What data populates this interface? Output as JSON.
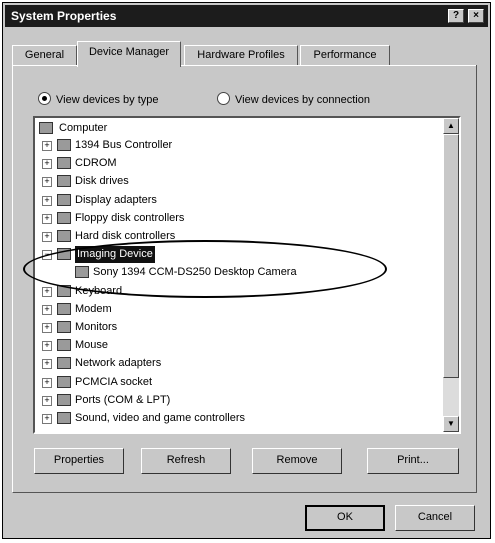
{
  "window": {
    "title": "System Properties",
    "help_btn": "?",
    "close_btn": "×"
  },
  "tabs": [
    {
      "label": "General"
    },
    {
      "label": "Device Manager"
    },
    {
      "label": "Hardware Profiles"
    },
    {
      "label": "Performance"
    }
  ],
  "radios": {
    "by_type": "View devices by type",
    "by_connection": "View devices by connection"
  },
  "tree": {
    "root": "Computer",
    "items": [
      {
        "label": "1394 Bus Controller",
        "icon": "bus-icon"
      },
      {
        "label": "CDROM",
        "icon": "cdrom-icon"
      },
      {
        "label": "Disk drives",
        "icon": "disk-icon"
      },
      {
        "label": "Display adapters",
        "icon": "display-icon"
      },
      {
        "label": "Floppy disk controllers",
        "icon": "floppy-icon"
      },
      {
        "label": "Hard disk controllers",
        "icon": "hdd-icon"
      },
      {
        "label": "Imaging Device",
        "icon": "camera-icon",
        "selected": true
      },
      {
        "label": "Sony 1394 CCM-DS250 Desktop Camera",
        "icon": "camera-icon",
        "child": true
      },
      {
        "label": "Keyboard",
        "icon": "keyboard-icon"
      },
      {
        "label": "Modem",
        "icon": "modem-icon"
      },
      {
        "label": "Monitors",
        "icon": "monitor-icon"
      },
      {
        "label": "Mouse",
        "icon": "mouse-icon"
      },
      {
        "label": "Network adapters",
        "icon": "network-icon"
      },
      {
        "label": "PCMCIA socket",
        "icon": "pcmcia-icon"
      },
      {
        "label": "Ports (COM & LPT)",
        "icon": "ports-icon"
      },
      {
        "label": "Sound, video and game controllers",
        "icon": "sound-icon"
      }
    ]
  },
  "buttons": {
    "properties": "Properties",
    "refresh": "Refresh",
    "remove": "Remove",
    "print": "Print...",
    "ok": "OK",
    "cancel": "Cancel"
  }
}
